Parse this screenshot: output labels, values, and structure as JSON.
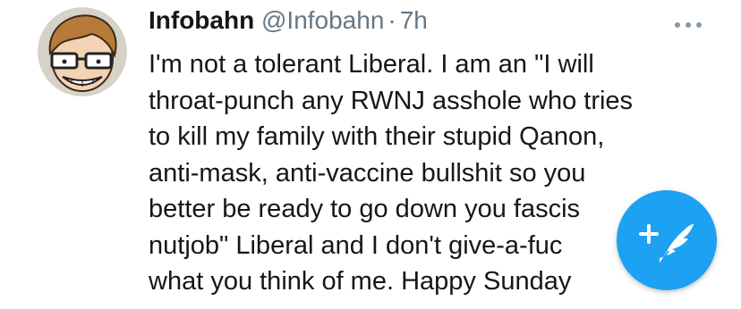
{
  "tweet": {
    "author_name": "Infobahn",
    "author_handle": "@Infobahn",
    "separator": "·",
    "time": "7h",
    "more_icon": "ellipsis-icon",
    "text_lines": [
      "I'm not a tolerant Liberal. I am an \"I will",
      "throat-punch any RWNJ asshole who tries",
      "to kill my family with their stupid Qanon,",
      "anti-mask, anti-vaccine bullshit so you",
      "better be ready to go down you fascis",
      "nutjob\" Liberal and I don't give-a-fuc",
      "what you think of me. Happy Sunday"
    ]
  },
  "compose": {
    "icon": "compose-feather-icon",
    "color": "#1da1f2"
  },
  "colors": {
    "text": "#14171a",
    "muted": "#657786",
    "accent": "#1da1f2"
  }
}
